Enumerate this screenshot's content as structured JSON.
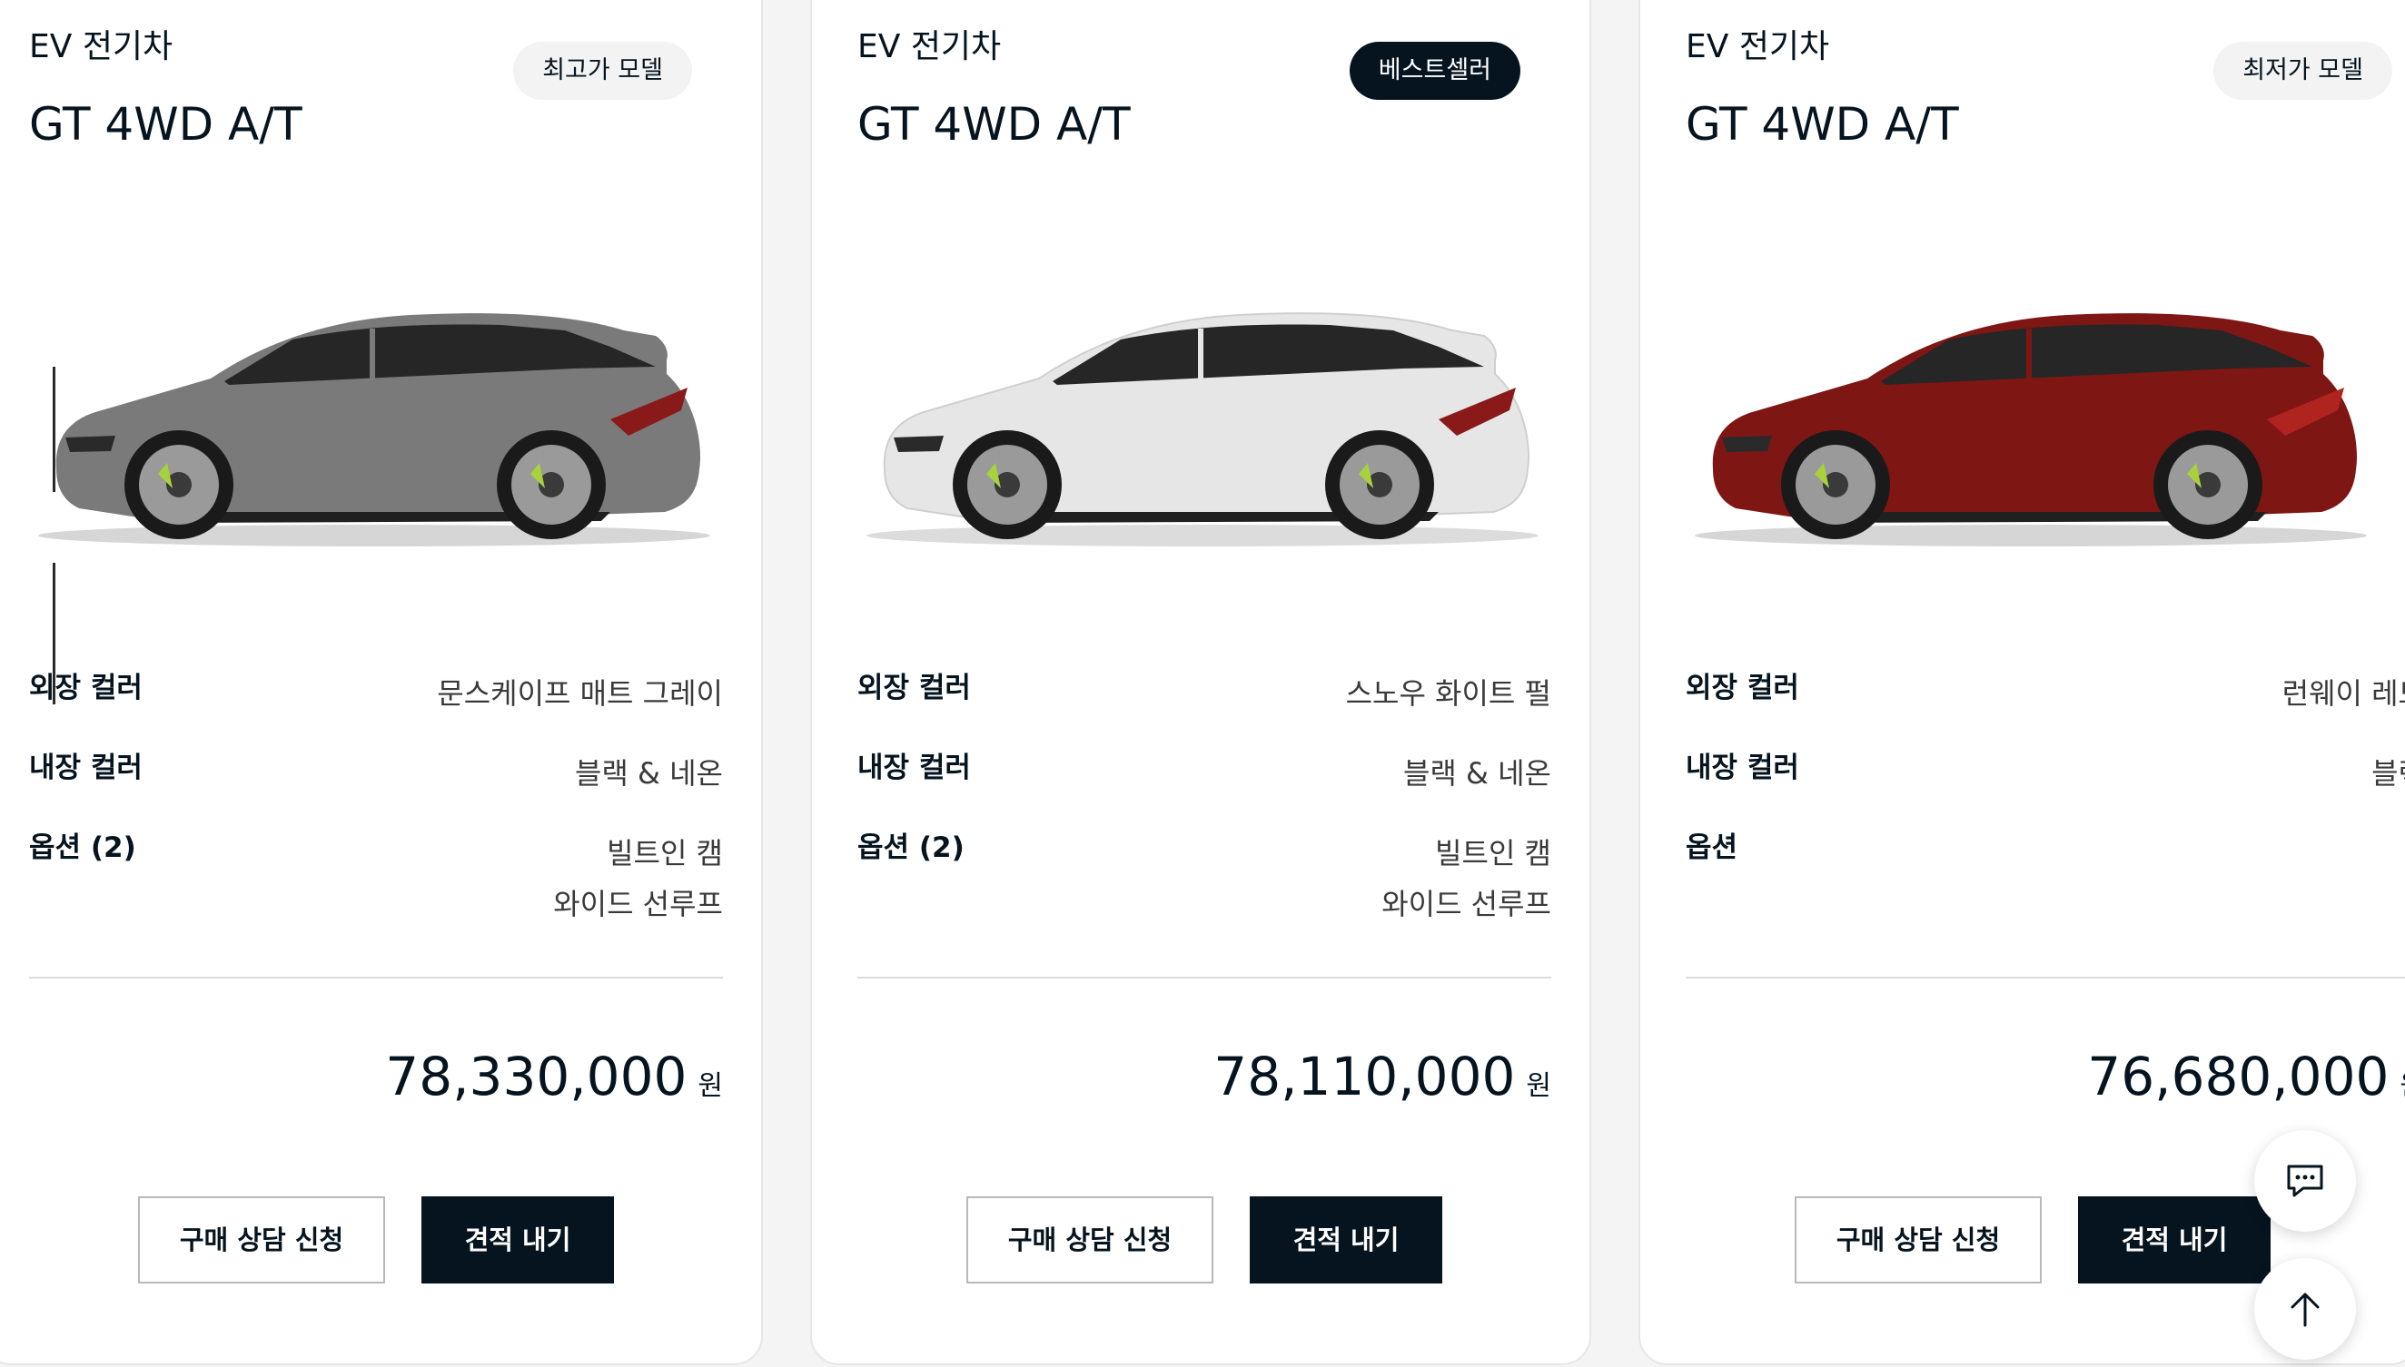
{
  "cards": [
    {
      "category": "EV 전기차",
      "model": "GT 4WD A/T",
      "badge": "최고가 모델",
      "car_color": "#7a7a7a",
      "specs": [
        {
          "label": "외장 컬러",
          "value": "문스케이프 매트 그레이"
        },
        {
          "label": "내장 컬러",
          "value": "블랙 & 네온"
        },
        {
          "label": "옵션 (2)",
          "value": "빌트인 캠",
          "value2": "와이드 선루프"
        }
      ],
      "price": "78,330,000",
      "price_unit": "원",
      "consult_label": "구매 상담 신청",
      "quote_label": "견적 내기"
    },
    {
      "category": "EV 전기차",
      "model": "GT 4WD A/T",
      "badge": "베스트셀러",
      "car_color": "#e4e4e4",
      "specs": [
        {
          "label": "외장 컬러",
          "value": "스노우 화이트 펄"
        },
        {
          "label": "내장 컬러",
          "value": "블랙 & 네온"
        },
        {
          "label": "옵션 (2)",
          "value": "빌트인 캠",
          "value2": "와이드 선루프"
        }
      ],
      "price": "78,110,000",
      "price_unit": "원",
      "consult_label": "구매 상담 신청",
      "quote_label": "견적 내기"
    },
    {
      "category": "EV 전기차",
      "model": "GT 4WD A/T",
      "badge": "최저가 모델",
      "car_color": "#7e1614",
      "specs": [
        {
          "label": "외장 컬러",
          "value": "런웨이 레드"
        },
        {
          "label": "내장 컬러",
          "value": "블랙"
        },
        {
          "label": "옵션",
          "value": "-"
        }
      ],
      "price": "76,680,000",
      "price_unit": "원",
      "consult_label": "구매 상담 신청",
      "quote_label": "견적 내기"
    }
  ],
  "floating": {
    "chat_icon": "chat-bubble-icon",
    "top_icon": "arrow-up-icon"
  },
  "colors": {
    "navy": "#05141f",
    "accent_green": "#a8d23c"
  }
}
